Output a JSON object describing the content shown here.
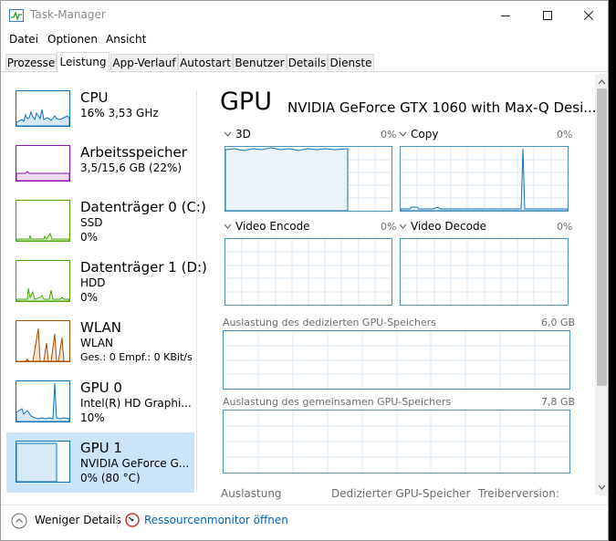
{
  "window": {
    "title": "Task-Manager"
  },
  "menu": [
    "Datei",
    "Optionen",
    "Ansicht"
  ],
  "tabs": [
    "Prozesse",
    "Leistung",
    "App-Verlauf",
    "Autostart",
    "Benutzer",
    "Details",
    "Dienste"
  ],
  "active_tab": "Leistung",
  "sidebar": {
    "items": [
      {
        "title": "CPU",
        "sub1": "16% 3,53 GHz",
        "sub2": "",
        "color": "#1172b6"
      },
      {
        "title": "Arbeitsspeicher",
        "sub1": "3,5/15,6 GB (22%)",
        "sub2": "",
        "color": "#8b12ae"
      },
      {
        "title": "Datenträger 0 (C:)",
        "sub1": "SSD",
        "sub2": "0%",
        "color": "#4da60c"
      },
      {
        "title": "Datenträger 1 (D:)",
        "sub1": "HDD",
        "sub2": "0%",
        "color": "#4da60c"
      },
      {
        "title": "WLAN",
        "sub1": "WLAN",
        "sub2": "Ges.: 0 Empf.: 0 KBit/s",
        "color": "#a74f01"
      },
      {
        "title": "GPU 0",
        "sub1": "Intel(R) HD Graphi...",
        "sub2": "10%",
        "color": "#1172b6"
      },
      {
        "title": "GPU 1",
        "sub1": "NVIDIA GeForce G...",
        "sub2": "0% (80 °C)",
        "color": "#1172b6"
      }
    ],
    "selected_index": 6
  },
  "detail": {
    "heading": "GPU",
    "model": "NVIDIA GeForce GTX 1060 with Max-Q Desi...",
    "engines": [
      {
        "name": "3D",
        "percent": "0%"
      },
      {
        "name": "Copy",
        "percent": "0%"
      },
      {
        "name": "Video Encode",
        "percent": "0%"
      },
      {
        "name": "Video Decode",
        "percent": "0%"
      }
    ],
    "dedicated_mem": {
      "label": "Auslastung des dedizierten GPU-Speichers",
      "capacity": "6,0 GB"
    },
    "shared_mem": {
      "label": "Auslastung des gemeinsamen GPU-Speichers",
      "capacity": "7,8 GB"
    },
    "stats": [
      "Auslastung",
      "Dedizierter GPU-Speicher",
      "Treiberversion:"
    ]
  },
  "footer": {
    "fewer_details": "Weniger Details",
    "resource_monitor": "Ressourcenmonitor öffnen"
  },
  "colors": {
    "gpu": "#1172b6",
    "graph_border": "#4b91b8",
    "link": "#0063b1",
    "selected": "#cce4f7"
  }
}
